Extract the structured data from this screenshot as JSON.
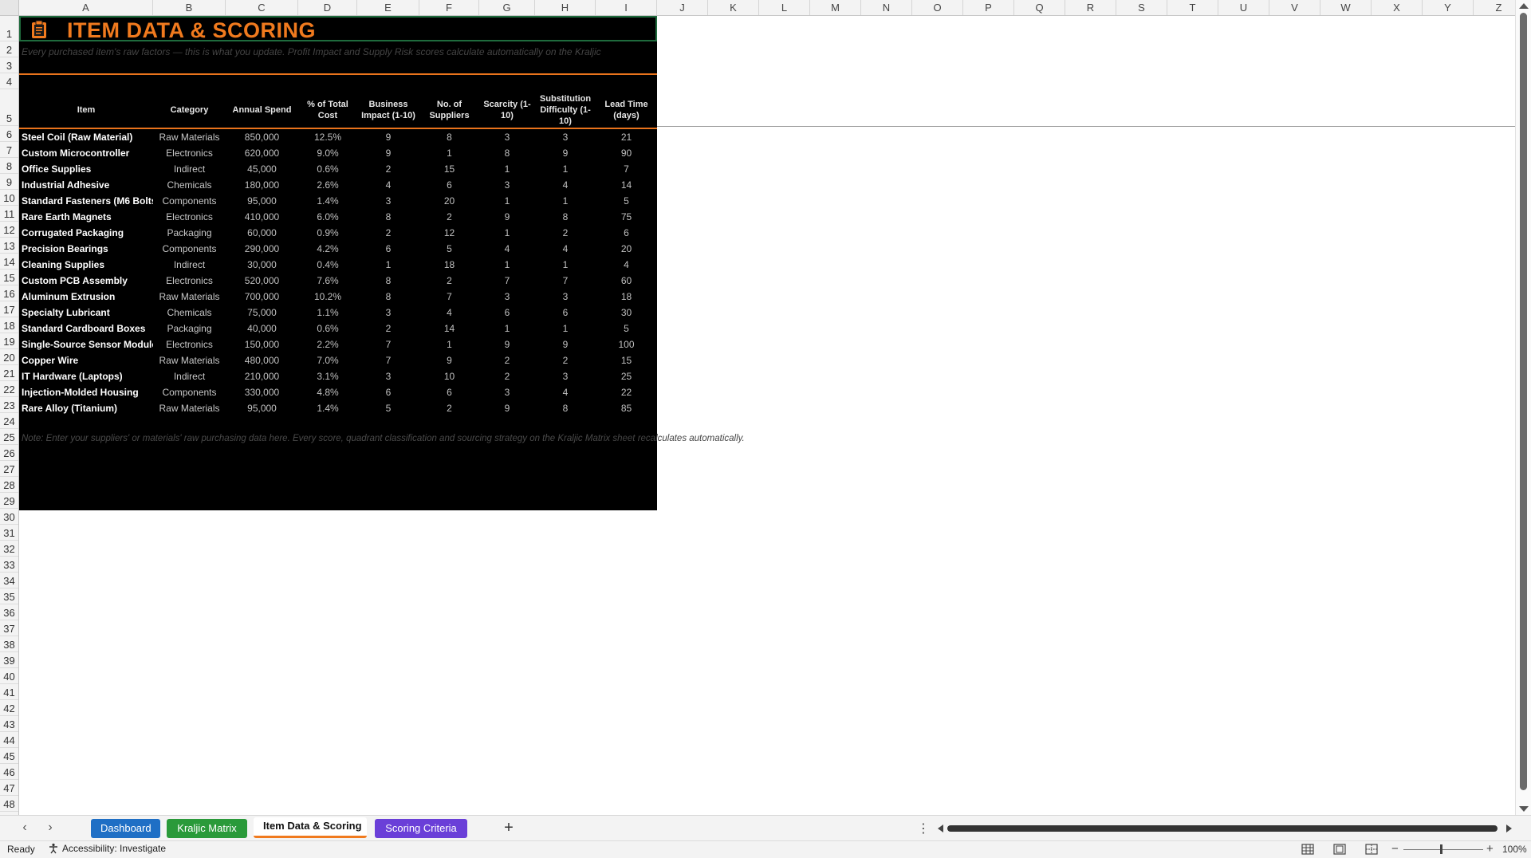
{
  "columns": [
    "A",
    "B",
    "C",
    "D",
    "E",
    "F",
    "G",
    "H",
    "I",
    "J",
    "K",
    "L",
    "M",
    "N",
    "O",
    "P",
    "Q",
    "R",
    "S",
    "T",
    "U",
    "V",
    "W",
    "X",
    "Y",
    "Z"
  ],
  "rows": [
    "1",
    "2",
    "3",
    "4",
    "5",
    "6",
    "7",
    "8",
    "9",
    "10",
    "11",
    "12",
    "13",
    "14",
    "15",
    "16",
    "17",
    "18",
    "19",
    "20",
    "21",
    "22",
    "23",
    "24",
    "25",
    "26",
    "27",
    "28",
    "29",
    "30",
    "31",
    "32",
    "33",
    "34",
    "35",
    "36",
    "37",
    "38",
    "39",
    "40",
    "41",
    "42",
    "43",
    "44",
    "45",
    "46",
    "47",
    "48"
  ],
  "sheet": {
    "title": "ITEM DATA & SCORING",
    "subtitle": "Every purchased item's raw factors — this is what you update. Profit Impact and Supply Risk scores calculate automatically on the Kraljic",
    "headers": [
      "Item",
      "Category",
      "Annual Spend",
      "% of Total Cost",
      "Business Impact (1-10)",
      "No. of Suppliers",
      "Scarcity (1-10)",
      "Substitution Difficulty (1-10)",
      "Lead Time (days)"
    ],
    "items": [
      [
        "Steel Coil (Raw Material)",
        "Raw Materials",
        "850,000",
        "12.5%",
        "9",
        "8",
        "3",
        "3",
        "21"
      ],
      [
        "Custom Microcontroller",
        "Electronics",
        "620,000",
        "9.0%",
        "9",
        "1",
        "8",
        "9",
        "90"
      ],
      [
        "Office Supplies",
        "Indirect",
        "45,000",
        "0.6%",
        "2",
        "15",
        "1",
        "1",
        "7"
      ],
      [
        "Industrial Adhesive",
        "Chemicals",
        "180,000",
        "2.6%",
        "4",
        "6",
        "3",
        "4",
        "14"
      ],
      [
        "Standard Fasteners (M6 Bolts",
        "Components",
        "95,000",
        "1.4%",
        "3",
        "20",
        "1",
        "1",
        "5"
      ],
      [
        "Rare Earth Magnets",
        "Electronics",
        "410,000",
        "6.0%",
        "8",
        "2",
        "9",
        "8",
        "75"
      ],
      [
        "Corrugated Packaging",
        "Packaging",
        "60,000",
        "0.9%",
        "2",
        "12",
        "1",
        "2",
        "6"
      ],
      [
        "Precision Bearings",
        "Components",
        "290,000",
        "4.2%",
        "6",
        "5",
        "4",
        "4",
        "20"
      ],
      [
        "Cleaning Supplies",
        "Indirect",
        "30,000",
        "0.4%",
        "1",
        "18",
        "1",
        "1",
        "4"
      ],
      [
        "Custom PCB Assembly",
        "Electronics",
        "520,000",
        "7.6%",
        "8",
        "2",
        "7",
        "7",
        "60"
      ],
      [
        "Aluminum Extrusion",
        "Raw Materials",
        "700,000",
        "10.2%",
        "8",
        "7",
        "3",
        "3",
        "18"
      ],
      [
        "Specialty Lubricant",
        "Chemicals",
        "75,000",
        "1.1%",
        "3",
        "4",
        "6",
        "6",
        "30"
      ],
      [
        "Standard Cardboard Boxes",
        "Packaging",
        "40,000",
        "0.6%",
        "2",
        "14",
        "1",
        "1",
        "5"
      ],
      [
        "Single-Source Sensor Module",
        "Electronics",
        "150,000",
        "2.2%",
        "7",
        "1",
        "9",
        "9",
        "100"
      ],
      [
        "Copper Wire",
        "Raw Materials",
        "480,000",
        "7.0%",
        "7",
        "9",
        "2",
        "2",
        "15"
      ],
      [
        "IT Hardware (Laptops)",
        "Indirect",
        "210,000",
        "3.1%",
        "3",
        "10",
        "2",
        "3",
        "25"
      ],
      [
        "Injection-Molded Housing",
        "Components",
        "330,000",
        "4.8%",
        "6",
        "6",
        "3",
        "4",
        "22"
      ],
      [
        "Rare Alloy (Titanium)",
        "Raw Materials",
        "95,000",
        "1.4%",
        "5",
        "2",
        "9",
        "8",
        "85"
      ]
    ],
    "note_head": "Note: Enter your suppliers' or materials' raw purchasing data here. Every score, quadrant classification and sourcing strategy on the Kraljic Matrix s",
    "note_tail": "heet recalculates automatically."
  },
  "tabs": {
    "dashboard": "Dashboard",
    "kraljic": "Kraljic Matrix",
    "item_data": "Item Data & Scoring",
    "scoring": "Scoring Criteria",
    "add": "+",
    "more": "⋮",
    "prev": "‹",
    "next": "›"
  },
  "status": {
    "ready": "Ready",
    "accessibility": "Accessibility: Investigate",
    "zoom": "100%",
    "zoom_minus": "−",
    "zoom_plus": "+"
  },
  "colors": {
    "title_orange": "#f07a1e",
    "tab_dashboard": "#1f6fc5",
    "tab_kraljic": "#2a9a3a",
    "tab_scoring": "#6a3fd8",
    "active_tab_underline": "#f07a1e"
  },
  "icons": {
    "title": "clipboard-icon",
    "accessibility": "accessibility-icon",
    "view_normal": "normal-view-icon",
    "view_page_layout": "page-layout-icon",
    "view_page_break": "page-break-icon"
  }
}
